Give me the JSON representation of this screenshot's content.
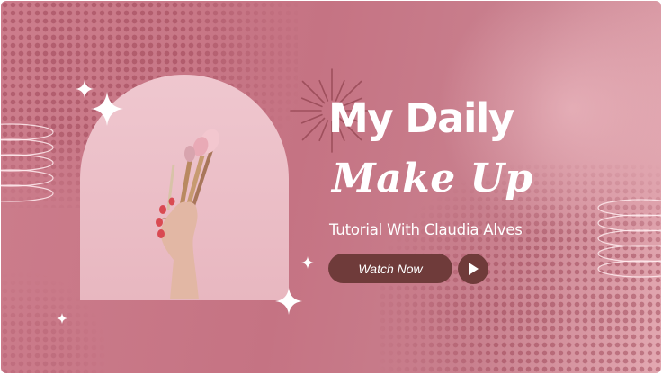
{
  "banner": {
    "title_line1": "My Daily",
    "title_line2": "Make Up",
    "subtitle": "Tutorial With Claudia Alves",
    "cta_label": "Watch Now"
  },
  "colors": {
    "background": "#c57383",
    "button": "#6f3b3a",
    "text": "#ffffff",
    "arch": "#efc7cf"
  },
  "icons": [
    "sparkle-icon",
    "rings-icon",
    "starburst-icon",
    "play-icon"
  ]
}
